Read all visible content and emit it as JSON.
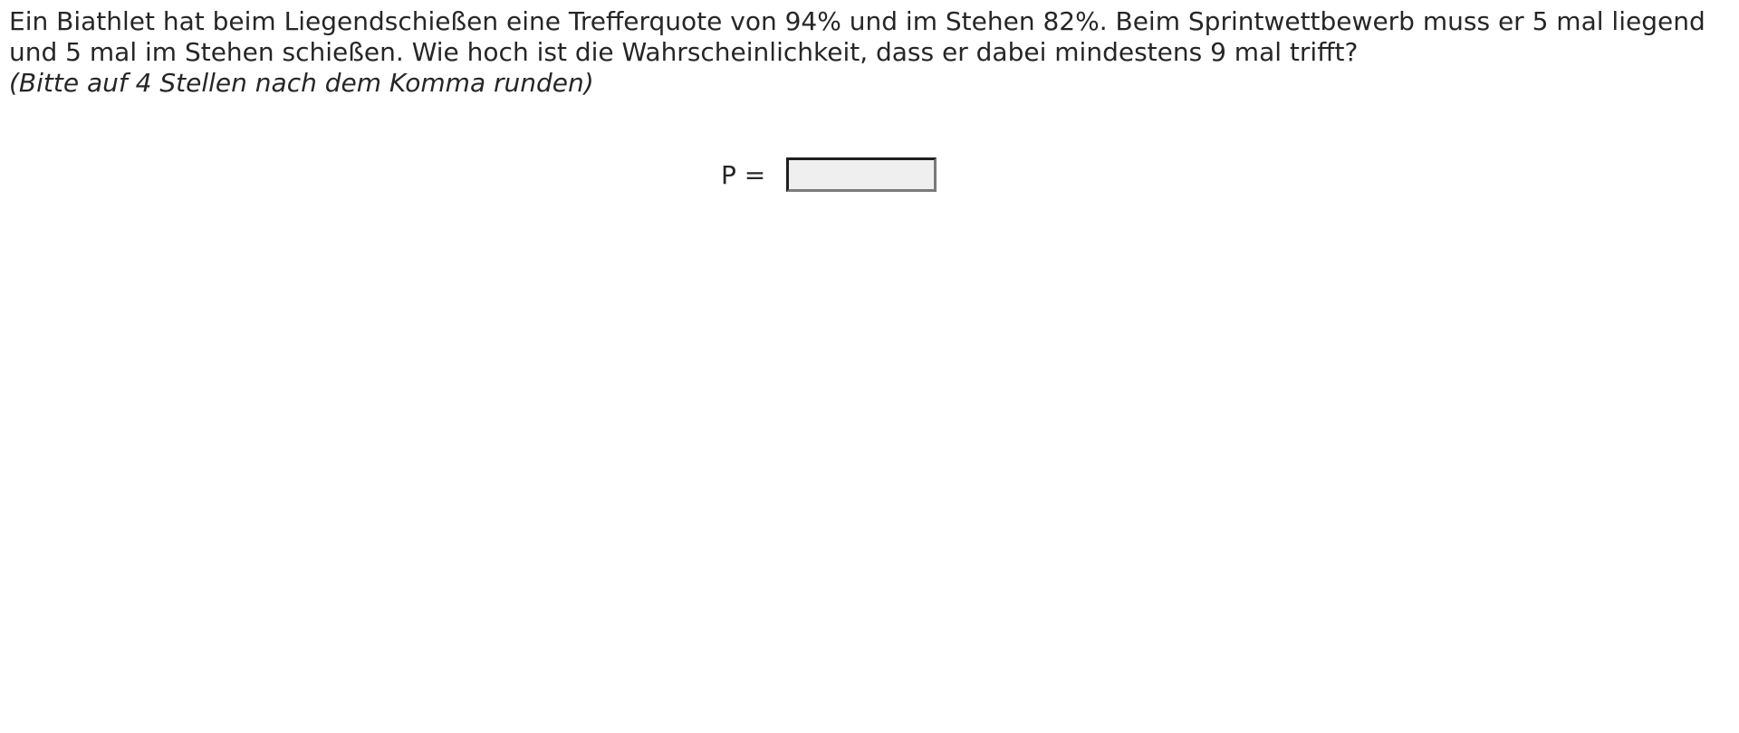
{
  "question": {
    "text": "Ein Biathlet hat beim Liegendschießen eine Trefferquote von 94% und im Stehen 82%. Beim Sprintwettbewerb muss er 5 mal liegend und 5 mal im Stehen schießen. Wie hoch ist die Wahrscheinlichkeit, dass er dabei mindestens 9 mal trifft?",
    "hint": "(Bitte auf 4 Stellen nach dem Komma runden)"
  },
  "answer": {
    "label": "P =",
    "value": ""
  }
}
